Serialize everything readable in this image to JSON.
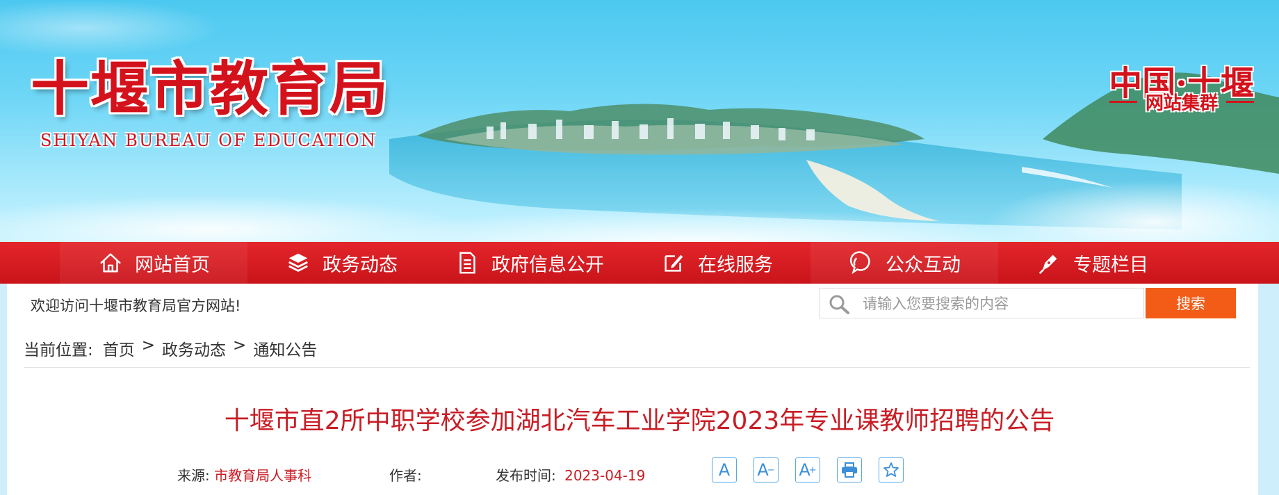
{
  "header": {
    "site_title": "十堰市教育局",
    "site_subtitle": "SHIYAN BUREAU OF EDUCATION",
    "group_title": "中国·十堰",
    "group_subtitle": "网站集群"
  },
  "nav": {
    "items": [
      {
        "label": "网站首页",
        "icon": "home-icon"
      },
      {
        "label": "政务动态",
        "icon": "layers-icon"
      },
      {
        "label": "政府信息公开",
        "icon": "document-icon"
      },
      {
        "label": "在线服务",
        "icon": "edit-icon"
      },
      {
        "label": "公众互动",
        "icon": "chat-icon"
      },
      {
        "label": "专题栏目",
        "icon": "pen-icon"
      }
    ]
  },
  "topbar": {
    "welcome": "欢迎访问十堰市教育局官方网站!",
    "search_placeholder": "请输入您要搜索的内容",
    "search_button": "搜索"
  },
  "breadcrumb": {
    "label": "当前位置:",
    "items": [
      "首页",
      "政务动态",
      "通知公告"
    ],
    "separator": ">"
  },
  "article": {
    "title": "十堰市直2所中职学校参加湖北汽车工业学院2023年专业课教师招聘的公告",
    "source_label": "来源:",
    "source": "市教育局人事科",
    "author_label": "作者:",
    "author": "",
    "date_label": "发布时间:",
    "date": "2023-04-19"
  },
  "tools": {
    "font_normal": "A",
    "font_smaller": "A",
    "font_larger": "A",
    "print_icon": "print-icon",
    "favorite_icon": "star-icon"
  },
  "colors": {
    "brand_red": "#d4121c",
    "nav_red": "#d71a20",
    "search_orange": "#f25c17",
    "title_red": "#c81d25",
    "tool_blue": "#3b8ed8"
  }
}
